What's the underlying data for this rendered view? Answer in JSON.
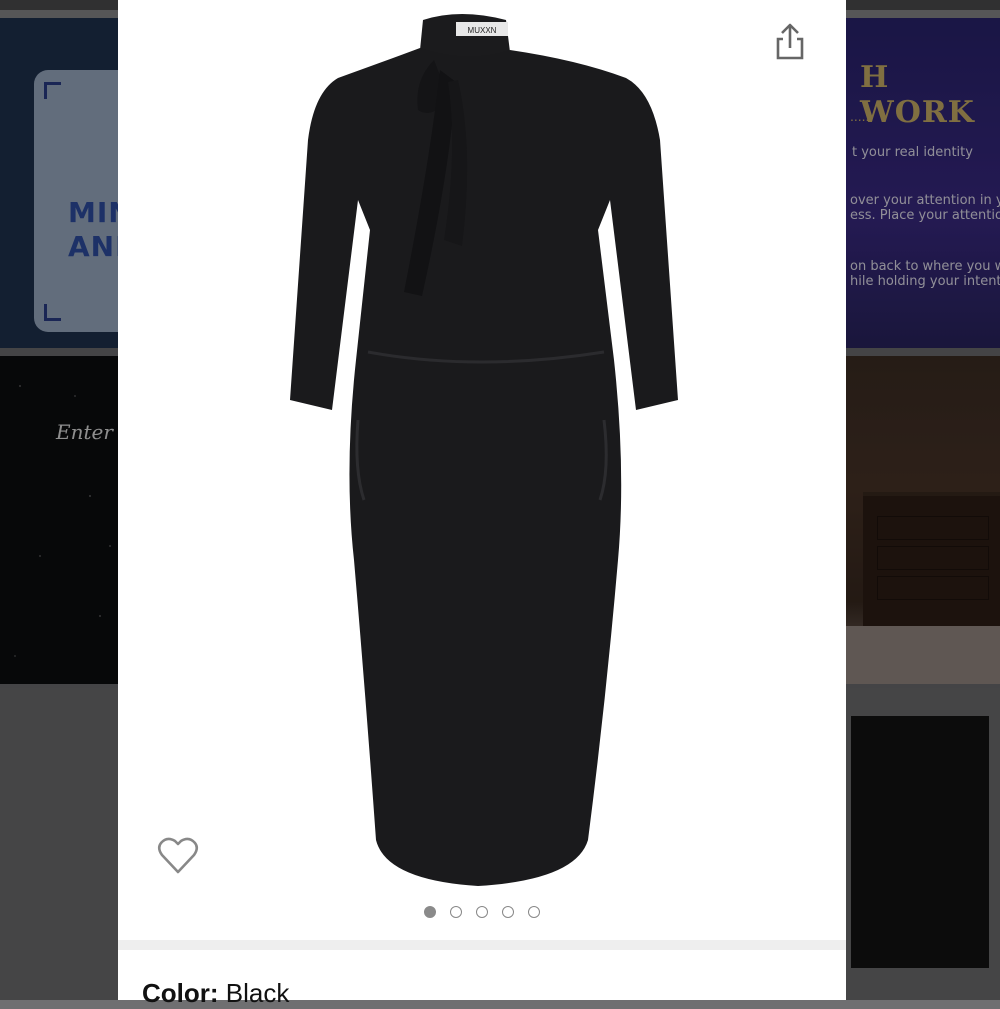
{
  "background": {
    "tile_left_top": {
      "lines": [
        "MIN",
        "AND"
      ]
    },
    "tile_left_mid": {
      "text": "Enter int"
    },
    "tile_right_top": {
      "title": "H WORK",
      "dots": "......",
      "lines": [
        "t your real identity",
        "over your attention in yo",
        "ess. Place your attention",
        "on back to where you we",
        "hile holding your intentio"
      ]
    }
  },
  "modal": {
    "product_brand_tag": "MUXXN",
    "carousel": {
      "total": 5,
      "active_index": 0
    },
    "color_label": "Color:",
    "color_value": "Black"
  },
  "colors": {
    "modal_bg": "#ffffff",
    "dress": "#1a1a1c",
    "icon_gray": "#8a8a8a",
    "accent_gold": "#cfb46a"
  },
  "icons": {
    "share": "share-icon",
    "favorite": "heart-icon"
  }
}
